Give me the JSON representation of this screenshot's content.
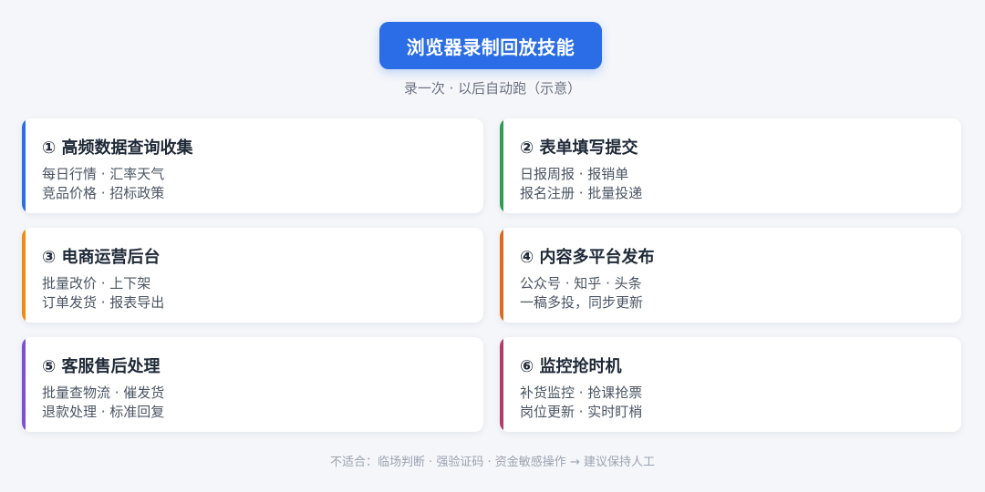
{
  "header": {
    "title": "浏览器录制回放技能",
    "subtitle": "录一次 · 以后自动跑（示意）"
  },
  "colors": {
    "title_bg": "#2b6de6",
    "card_1": "#2b6de6",
    "card_2": "#2e9e52",
    "card_3": "#f08a12",
    "card_4": "#e06a1c",
    "card_5": "#7b4fd6",
    "card_6": "#b43a6a"
  },
  "cards": [
    {
      "title": "① 高频数据查询收集",
      "line1": "每日行情 · 汇率天气",
      "line2": "竞品价格 · 招标政策"
    },
    {
      "title": "② 表单填写提交",
      "line1": "日报周报 · 报销单",
      "line2": "报名注册 · 批量投递"
    },
    {
      "title": "③ 电商运营后台",
      "line1": "批量改价 · 上下架",
      "line2": "订单发货 · 报表导出"
    },
    {
      "title": "④ 内容多平台发布",
      "line1": "公众号 · 知乎 · 头条",
      "line2": "一稿多投，同步更新"
    },
    {
      "title": "⑤ 客服售后处理",
      "line1": "批量查物流 · 催发货",
      "line2": "退款处理 · 标准回复"
    },
    {
      "title": "⑥ 监控抢时机",
      "line1": "补货监控 · 抢课抢票",
      "line2": "岗位更新 · 实时盯梢"
    }
  ],
  "footer": {
    "note": "不适合：临场判断 · 强验证码 · 资金敏感操作 → 建议保持人工"
  }
}
